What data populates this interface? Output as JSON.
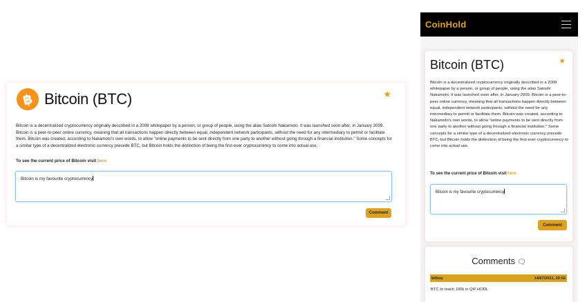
{
  "desktop": {
    "coin_title": "Bitcoin (BTC)",
    "logo_glyph": "฿",
    "description": "Bitcoin is a decentralized cryptocurrency originally described in a 2008 whitepaper by a person, or group of people, using the alias Satoshi Nakamoto. It was launched soon after, in January 2009. Bitcoin is a peer-to-peer online currency, meaning that all transactions happen directly between equal, independent network participants, without the need for any intermediary to permit or facilitate them. Bitcoin was created, according to Nakamoto's own words, to allow \"online payments to be sent directly from one party to another without going through a financial institution.\" Some concepts for a similar type of a decentralized electronic currency precede BTC, but Bitcoin holds the distinction of being the first-ever cryptocurrency to come into actual use.",
    "price_prompt": "To see the current price of Bitcoin visit ",
    "price_link": "here",
    "comment_value": "Bitcoin is my favourite cryptocurrency",
    "comment_button": "Comment",
    "star": "★"
  },
  "mobile": {
    "brand": "CoinHold",
    "coin_title": "Bitcoin (BTC)",
    "star": "★",
    "price_prompt": "To see the current price of Bitcoin visit ",
    "price_link": "here",
    "comment_value": "Bitcoin is my favourite cryptocurrency",
    "comment_button": "Comment",
    "comments_title": "Comments",
    "comments": [
      {
        "user": "bitboy",
        "timestamp": "14/07/2021, 20:02",
        "text": "BTC to reach 100k in Q4! HODL"
      }
    ]
  },
  "colors": {
    "accent": "#e0a21c",
    "navbar": "#000000",
    "bitcoin_orange": "#f7931a",
    "input_focus": "#8ec3ee"
  },
  "icons": {
    "favourite": "star-icon",
    "menu": "hamburger-menu-icon",
    "comments": "comments-icon",
    "logo": "bitcoin-logo"
  }
}
